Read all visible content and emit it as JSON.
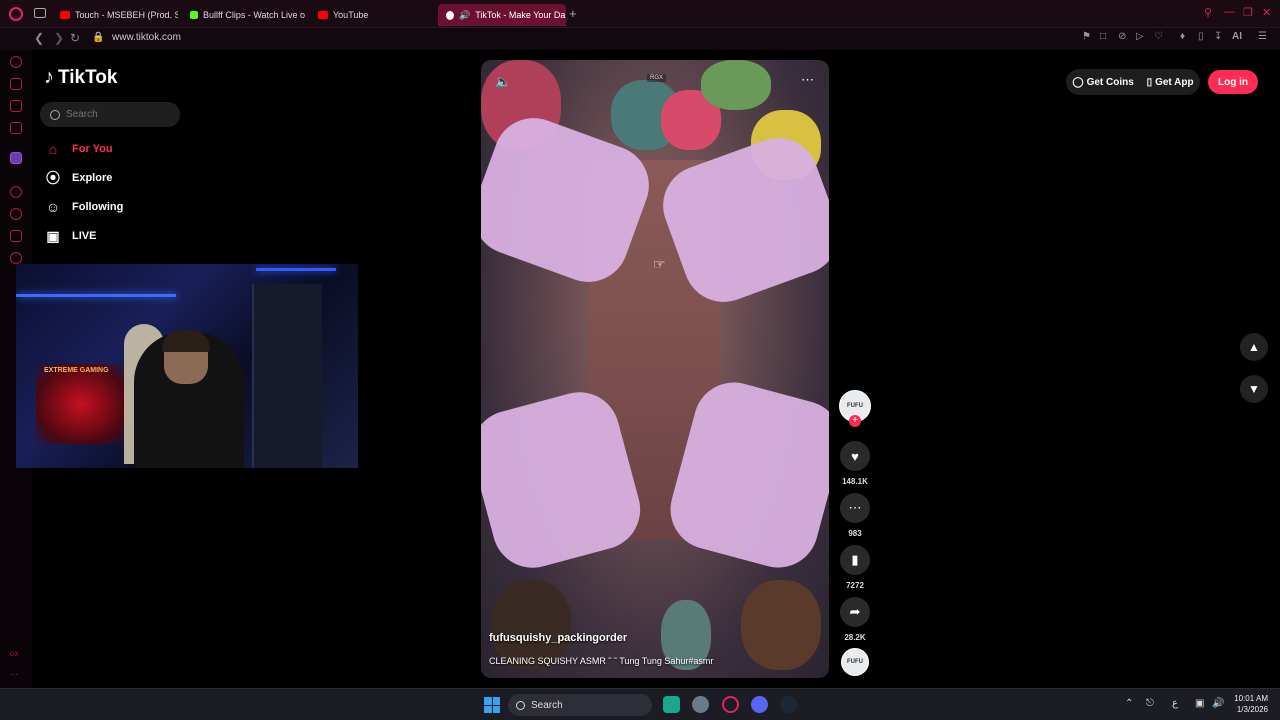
{
  "browser": {
    "tabs": [
      {
        "label": "Touch - MSEBEH (Prod. Sl",
        "favicon": "youtube-icon",
        "active": false
      },
      {
        "label": "Bullff Clips - Watch Live o",
        "favicon": "kick-icon",
        "active": false
      },
      {
        "label": "YouTube",
        "favicon": "youtube-icon",
        "active": false
      },
      {
        "label": "TikTok - Make Your Da",
        "favicon": "tiktok-icon",
        "active": true
      }
    ],
    "new_tab": "+",
    "url": "www.tiktok.com",
    "accent": "#e0245e",
    "ai_label": "AI"
  },
  "tiktok": {
    "logo_text": "TikTok",
    "search_placeholder": "Search",
    "nav": [
      {
        "label": "For You",
        "icon": "home-icon",
        "active": true
      },
      {
        "label": "Explore",
        "icon": "compass-icon",
        "active": false
      },
      {
        "label": "Following",
        "icon": "user-follow-icon",
        "active": false
      },
      {
        "label": "LIVE",
        "icon": "tv-icon",
        "active": false
      }
    ],
    "header": {
      "get_coins": "Get Coins",
      "get_app": "Get App",
      "login": "Log in"
    },
    "brand_color": "#fe2c55"
  },
  "webcam": {
    "sign_text": "EXTREME GAMING"
  },
  "video": {
    "badge": "RGX",
    "username": "fufusquishy_packingorder",
    "caption": "CLEANING SQUISHY ASMR ˜ ˜ Tung Tung Sahur#asmr",
    "avatar_text": "FUFU"
  },
  "actions": {
    "likes": "148.1K",
    "comments": "983",
    "saves": "7272",
    "shares": "28.2K"
  },
  "taskbar": {
    "search_label": "Search",
    "time": "10:01 AM",
    "date": "1/3/2026",
    "lang": "ع"
  }
}
